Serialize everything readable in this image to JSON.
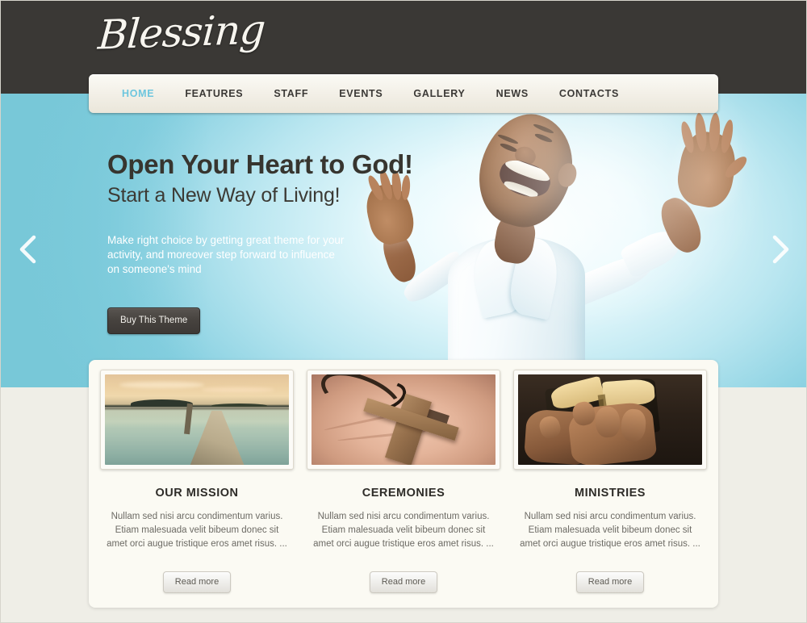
{
  "site": {
    "logo_text": "Blessing"
  },
  "nav": {
    "items": [
      {
        "label": "HOME",
        "active": true
      },
      {
        "label": "FEATURES",
        "active": false
      },
      {
        "label": "STAFF",
        "active": false
      },
      {
        "label": "EVENTS",
        "active": false
      },
      {
        "label": "GALLERY",
        "active": false
      },
      {
        "label": "NEWS",
        "active": false
      },
      {
        "label": "CONTACTS",
        "active": false
      }
    ]
  },
  "hero": {
    "title": "Open Your Heart to God!",
    "subtitle": "Start a New Way of Living!",
    "description": "Make right choice by getting great theme for your activity, and moreover step forward to influence on someone's mind",
    "button_label": "Buy This Theme",
    "prev_icon": "chevron-left-icon",
    "next_icon": "chevron-right-icon",
    "image_alt": "Joyful man with arms raised to the sky"
  },
  "cards": [
    {
      "title": "OUR MISSION",
      "text": "Nullam sed nisi arcu condimentum varius. Etiam malesuada velit bibeum donec sit amet orci augue tristique eros amet risus. ...",
      "button_label": "Read more",
      "image_alt": "Wooden pier on a calm lake at sunset"
    },
    {
      "title": "CEREMONIES",
      "text": "Nullam sed nisi arcu condimentum varius. Etiam malesuada velit bibeum donec sit amet orci augue tristique eros amet risus. ...",
      "button_label": "Read more",
      "image_alt": "Wooden cross resting in an open hand"
    },
    {
      "title": "MINISTRIES",
      "text": "Nullam sed nisi arcu condimentum varius. Etiam malesuada velit bibeum donec sit amet orci augue tristique eros amet risus. ...",
      "button_label": "Read more",
      "image_alt": "Hands holding an open Bible"
    }
  ],
  "colors": {
    "header_dark": "#3a3835",
    "hero_cyan": "#78c8d8",
    "nav_active": "#6ec6de",
    "page_bg": "#efeee7",
    "panel_bg": "#fbfaf3",
    "nav_bg": "#f4f1e8"
  }
}
